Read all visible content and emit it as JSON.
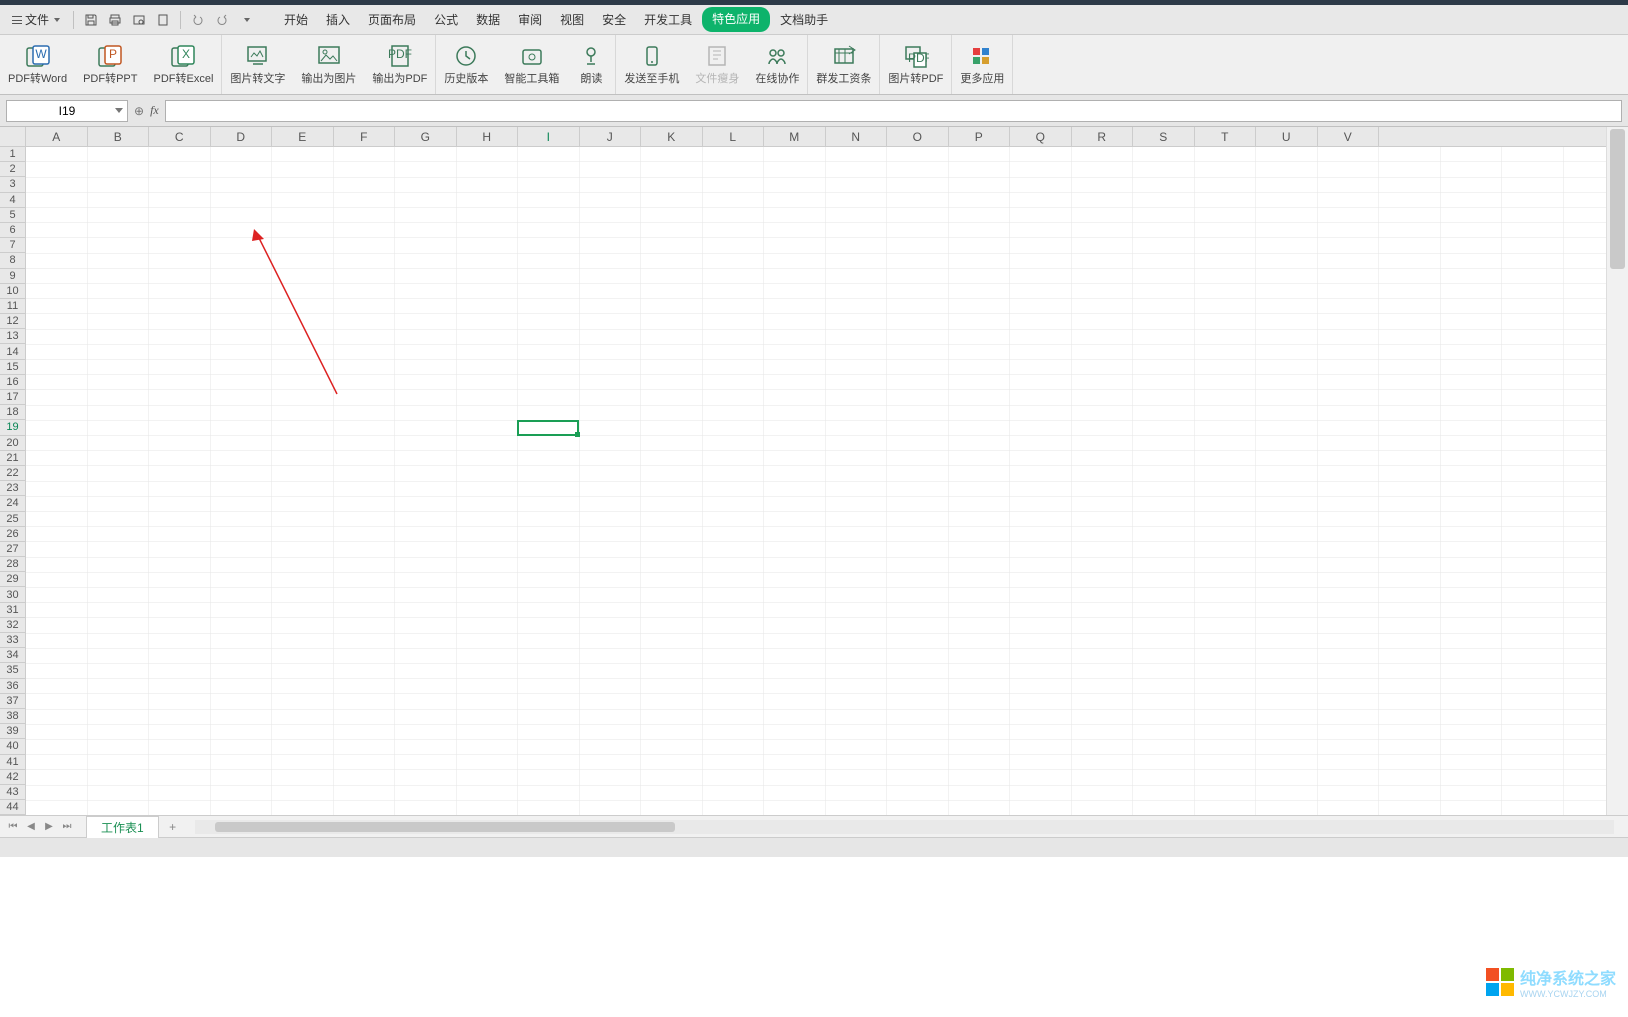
{
  "menubar": {
    "file_label": "文件",
    "tabs": [
      "开始",
      "插入",
      "页面布局",
      "公式",
      "数据",
      "审阅",
      "视图",
      "安全",
      "开发工具",
      "特色应用",
      "文档助手"
    ]
  },
  "ribbon": {
    "groups": [
      {
        "items": [
          {
            "label": "PDF转Word",
            "icon": "pdf-to-word-icon"
          },
          {
            "label": "PDF转PPT",
            "icon": "pdf-to-ppt-icon"
          },
          {
            "label": "PDF转Excel",
            "icon": "pdf-to-excel-icon"
          }
        ]
      },
      {
        "items": [
          {
            "label": "图片转文字",
            "icon": "image-to-text-icon"
          },
          {
            "label": "输出为图片",
            "icon": "export-image-icon"
          },
          {
            "label": "输出为PDF",
            "icon": "export-pdf-icon"
          }
        ]
      },
      {
        "items": [
          {
            "label": "历史版本",
            "icon": "history-icon"
          },
          {
            "label": "智能工具箱",
            "icon": "smart-tools-icon"
          },
          {
            "label": "朗读",
            "icon": "read-aloud-icon"
          }
        ]
      },
      {
        "items": [
          {
            "label": "发送至手机",
            "icon": "send-phone-icon"
          },
          {
            "label": "文件瘦身",
            "icon": "compress-icon",
            "disabled": true
          },
          {
            "label": "在线协作",
            "icon": "collab-icon"
          }
        ]
      },
      {
        "items": [
          {
            "label": "群发工资条",
            "icon": "payslip-icon"
          }
        ]
      },
      {
        "items": [
          {
            "label": "图片转PDF",
            "icon": "image-to-pdf-icon"
          }
        ]
      },
      {
        "items": [
          {
            "label": "更多应用",
            "icon": "more-apps-icon"
          }
        ]
      }
    ]
  },
  "fxbar": {
    "cell_ref": "I19",
    "formula": ""
  },
  "sheet": {
    "columns": [
      "A",
      "B",
      "C",
      "D",
      "E",
      "F",
      "G",
      "H",
      "I",
      "J",
      "K",
      "L",
      "M",
      "N",
      "O",
      "P",
      "Q",
      "R",
      "S",
      "T",
      "U",
      "V"
    ],
    "row_count": 44,
    "selected_cell": "I19",
    "selected_row": 19,
    "selected_col_index": 8
  },
  "sheettabs": {
    "tab1": "工作表1"
  },
  "watermark": {
    "line1": "纯净系统之家",
    "line2": "WWW.YCWJZY.COM"
  }
}
